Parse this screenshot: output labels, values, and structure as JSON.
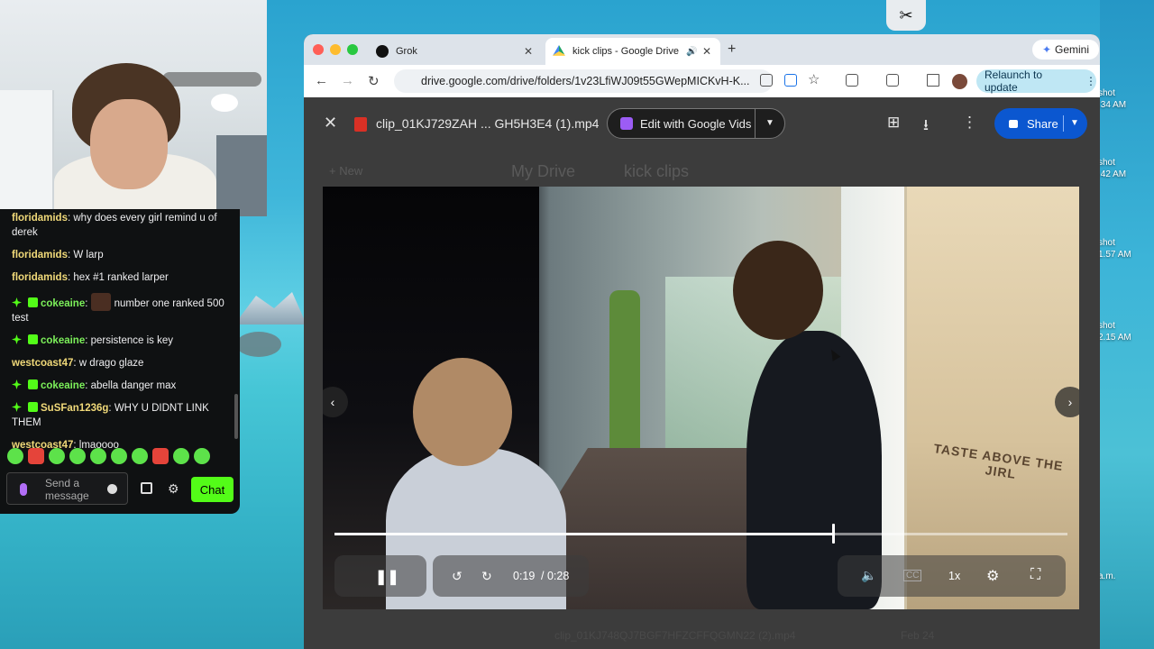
{
  "chat": {
    "messages": [
      {
        "user": "floridamids",
        "color": "yellow",
        "badges": false,
        "text": "why does every girl remind u of derek"
      },
      {
        "user": "floridamids",
        "color": "yellow",
        "badges": false,
        "text": "W larp"
      },
      {
        "user": "floridamids",
        "color": "yellow",
        "badges": false,
        "text": "hex #1 ranked larper"
      },
      {
        "user": "cokeaine",
        "color": "green",
        "badges": true,
        "emote": true,
        "text": "number one ranked 500 test"
      },
      {
        "user": "cokeaine",
        "color": "green",
        "badges": true,
        "text": "persistence is key"
      },
      {
        "user": "westcoast47",
        "color": "yellow",
        "badges": false,
        "text": "w drago glaze"
      },
      {
        "user": "cokeaine",
        "color": "green",
        "badges": true,
        "text": "abella danger max"
      },
      {
        "user": "SuSFan1236g",
        "color": "yellow",
        "badges": true,
        "text": "WHY U DIDNT LINK THEM"
      },
      {
        "user": "westcoast47",
        "color": "yellow",
        "badges": false,
        "text": "lmaoooo"
      }
    ],
    "input_placeholder": "Send a message",
    "send_label": "Chat",
    "accent_color": "#53fc18"
  },
  "browser": {
    "tabs": [
      {
        "label": "Grok",
        "icon": "grok-icon"
      },
      {
        "label": "kick clips - Google Drive",
        "icon": "google-drive-icon",
        "active": true
      }
    ],
    "gemini_label": "Gemini",
    "url": "drive.google.com/drive/folders/1v23LfiWJ09t55GWepMICKvH-K...",
    "relaunch_label": "Relaunch to update"
  },
  "drive": {
    "file_name": "clip_01KJ729ZAH ... GH5H3E4 (1).mp4",
    "edit_label": "Edit with Google Vids",
    "share_label": "Share",
    "breadcrumb_root": "My Drive",
    "breadcrumb_folder": "kick clips",
    "new_label": "New",
    "below_file": "clip_01KJ748QJ7BGF7HFZCFFQGMN22 (2).mp4",
    "below_date": "Feb 24"
  },
  "player": {
    "current_time": "0:19",
    "duration": "/ 0:28",
    "progress": 0.68,
    "speed": "1x",
    "sign_text": "TASTE ABOVE THE",
    "sign_text2": "JIRL"
  },
  "desktop": {
    "labels": [
      "shot",
      ".34 AM",
      "shot",
      ".42 AM",
      "shot",
      "1.57 AM",
      "shot",
      "2.15 AM",
      "a.m."
    ]
  }
}
